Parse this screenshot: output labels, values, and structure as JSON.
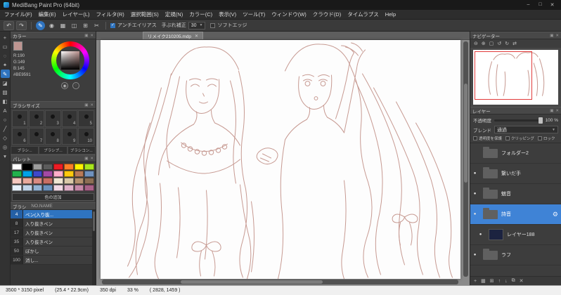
{
  "titlebar": {
    "title": "MediBang Paint Pro (64bit)",
    "minimize": "–",
    "maximize": "□",
    "close": "✕"
  },
  "menubar": {
    "items": [
      "ファイル(F)",
      "編集(E)",
      "レイヤー(L)",
      "フィルタ(R)",
      "選択範囲(S)",
      "定規(N)",
      "カラー(C)",
      "表示(V)",
      "ツール(T)",
      "ウィンドウ(W)",
      "クラウド(D)",
      "タイムラプス",
      "Help"
    ]
  },
  "toolbar": {
    "antialias": "アンチエイリアス",
    "stabilizer": "手ぶれ補正",
    "stabilizer_value": "30",
    "softedge": "ソフトエッジ"
  },
  "color_panel": {
    "title": "カラー",
    "r": "R:190",
    "g": "G:149",
    "b": "B:145",
    "hex": "#BE9591",
    "current_color": "#BE9591"
  },
  "brush_size_panel": {
    "title": "ブラシサイズ",
    "sizes": [
      "1",
      "2",
      "3",
      "4",
      "5",
      "6",
      "7",
      "8",
      "9",
      "10"
    ]
  },
  "brush_tabs": {
    "tab1": "ブラシ...",
    "tab2": "ブラシプ...",
    "tab3": "ブラシコン..."
  },
  "palette_panel": {
    "title": "パレット",
    "add_button": "色の追加",
    "colors": [
      "#ffffff",
      "#000000",
      "#9c9c9c",
      "#5b5b5b",
      "#ec1c24",
      "#ff7f27",
      "#fff200",
      "#a8e61d",
      "#22b14c",
      "#00a2e8",
      "#3f48cc",
      "#a349a4",
      "#ffaec9",
      "#ffc90e",
      "#b97a57",
      "#7092be",
      "#f5c8c0",
      "#e8a99c",
      "#d98b82",
      "#c96f64",
      "#f0e6d2",
      "#d9c9a8",
      "#b5916f",
      "#8c6e54",
      "#e6f0fa",
      "#c0d3e8",
      "#93b3d4",
      "#6e93bd",
      "#f2d8e4",
      "#dfb0c8",
      "#c688a8",
      "#a86288"
    ]
  },
  "brush_list": {
    "title": "ブラシ",
    "columns": "NO.NAME",
    "items": [
      {
        "no": "4",
        "name": "ペン(入り抜..."
      },
      {
        "no": "8",
        "name": "入り抜きペン"
      },
      {
        "no": "17",
        "name": "入り抜きペン"
      },
      {
        "no": "35",
        "name": "入り抜きペン"
      },
      {
        "no": "50",
        "name": "ぼかし"
      },
      {
        "no": "100",
        "name": "消し..."
      }
    ]
  },
  "canvas": {
    "tab": "リメイク210205.mdp",
    "close": "✕"
  },
  "navigator": {
    "title": "ナビゲーター"
  },
  "layer_panel": {
    "title": "レイヤー",
    "opacity_label": "不透明度",
    "opacity_value": "100 %",
    "blend_label": "ブレンド",
    "blend_value": "通過",
    "protect_label": "透明度を保護",
    "clipping_label": "クリッピング",
    "lock_label": "ロック",
    "layers": [
      {
        "name": "フォルダー2",
        "type": "folder",
        "visible": false,
        "selected": false
      },
      {
        "name": "繋いだ手",
        "type": "folder",
        "visible": true,
        "selected": false
      },
      {
        "name": "魅音",
        "type": "folder",
        "visible": true,
        "selected": false
      },
      {
        "name": "詩音",
        "type": "folder",
        "visible": true,
        "selected": true
      },
      {
        "name": "レイヤー188",
        "type": "layer",
        "visible": true,
        "selected": false
      },
      {
        "name": "ラフ",
        "type": "folder",
        "visible": true,
        "selected": false
      }
    ]
  },
  "statusbar": {
    "size": "3500 * 3150 pixel",
    "size_cm": "(25.4 * 22.9cm)",
    "dpi": "350 dpi",
    "zoom": "33 %",
    "coords": "( 2828, 1459 )"
  }
}
